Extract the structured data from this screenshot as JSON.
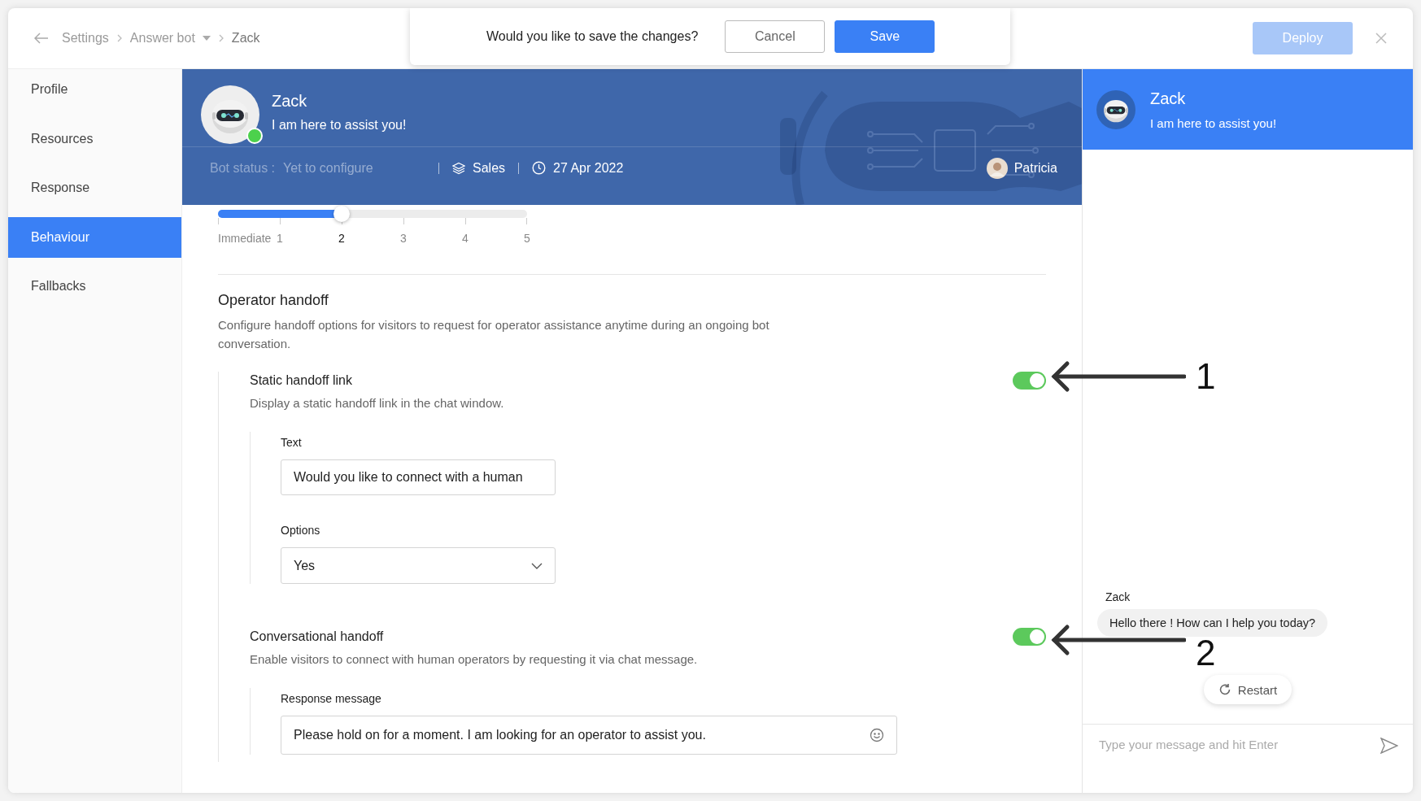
{
  "topbar": {
    "breadcrumbs": [
      {
        "label": "Settings",
        "kind": "link"
      },
      {
        "label": "Answer bot",
        "kind": "dropdown"
      },
      {
        "label": "Zack",
        "kind": "current"
      }
    ],
    "deploy_button": {
      "label": "Deploy",
      "disabled": true
    }
  },
  "save_prompt": {
    "message": "Would you like to save the changes?",
    "buttons": [
      {
        "label": "Cancel",
        "kind": "secondary"
      },
      {
        "label": "Save",
        "kind": "primary"
      }
    ]
  },
  "sidebar": {
    "items": [
      {
        "label": "Profile",
        "selected": false
      },
      {
        "label": "Resources",
        "selected": false
      },
      {
        "label": "Response",
        "selected": false
      },
      {
        "label": "Behaviour",
        "selected": true
      },
      {
        "label": "Fallbacks",
        "selected": false
      }
    ]
  },
  "bot_header": {
    "name": "Zack",
    "tagline": "I am here to assist you!",
    "online": true,
    "status_label": "Bot status :",
    "status_value": "Yet to configure",
    "department": "Sales",
    "date": "27 Apr 2022",
    "owner": "Patricia"
  },
  "delay_slider": {
    "level": 0.4,
    "stops": [
      {
        "label": "Immediate",
        "selected": false
      },
      {
        "label": "1",
        "selected": false
      },
      {
        "label": "2",
        "selected": true
      },
      {
        "label": "3",
        "selected": false
      },
      {
        "label": "4",
        "selected": false
      },
      {
        "label": "5",
        "selected": false
      }
    ]
  },
  "operator_handoff": {
    "title": "Operator handoff",
    "description": "Configure handoff options for visitors to request for operator assistance anytime during an ongoing bot conversation.",
    "options": [
      {
        "title": "Static handoff link",
        "description": "Display a static handoff link in the chat window.",
        "on": true,
        "fields": [
          {
            "kind": "text",
            "label": "Text",
            "value": "Would you like to connect with a human"
          },
          {
            "kind": "select",
            "label": "Options",
            "value": "Yes"
          }
        ]
      },
      {
        "title": "Conversational handoff",
        "description": "Enable visitors to connect with human operators by requesting it via chat message.",
        "on": true,
        "fields": [
          {
            "kind": "message",
            "label": "Response message",
            "value": "Please hold on for a moment. I am looking for an operator to assist you."
          }
        ]
      }
    ]
  },
  "preview": {
    "name": "Zack",
    "tagline": "I am here to assist you!",
    "messages": [
      {
        "sender": "Zack",
        "text": "Hello there ! How can I help you today?"
      }
    ],
    "restart_button": "Restart",
    "input_placeholder": "Type your message and hit Enter"
  },
  "annotations": [
    {
      "label": "1"
    },
    {
      "label": "2"
    }
  ]
}
